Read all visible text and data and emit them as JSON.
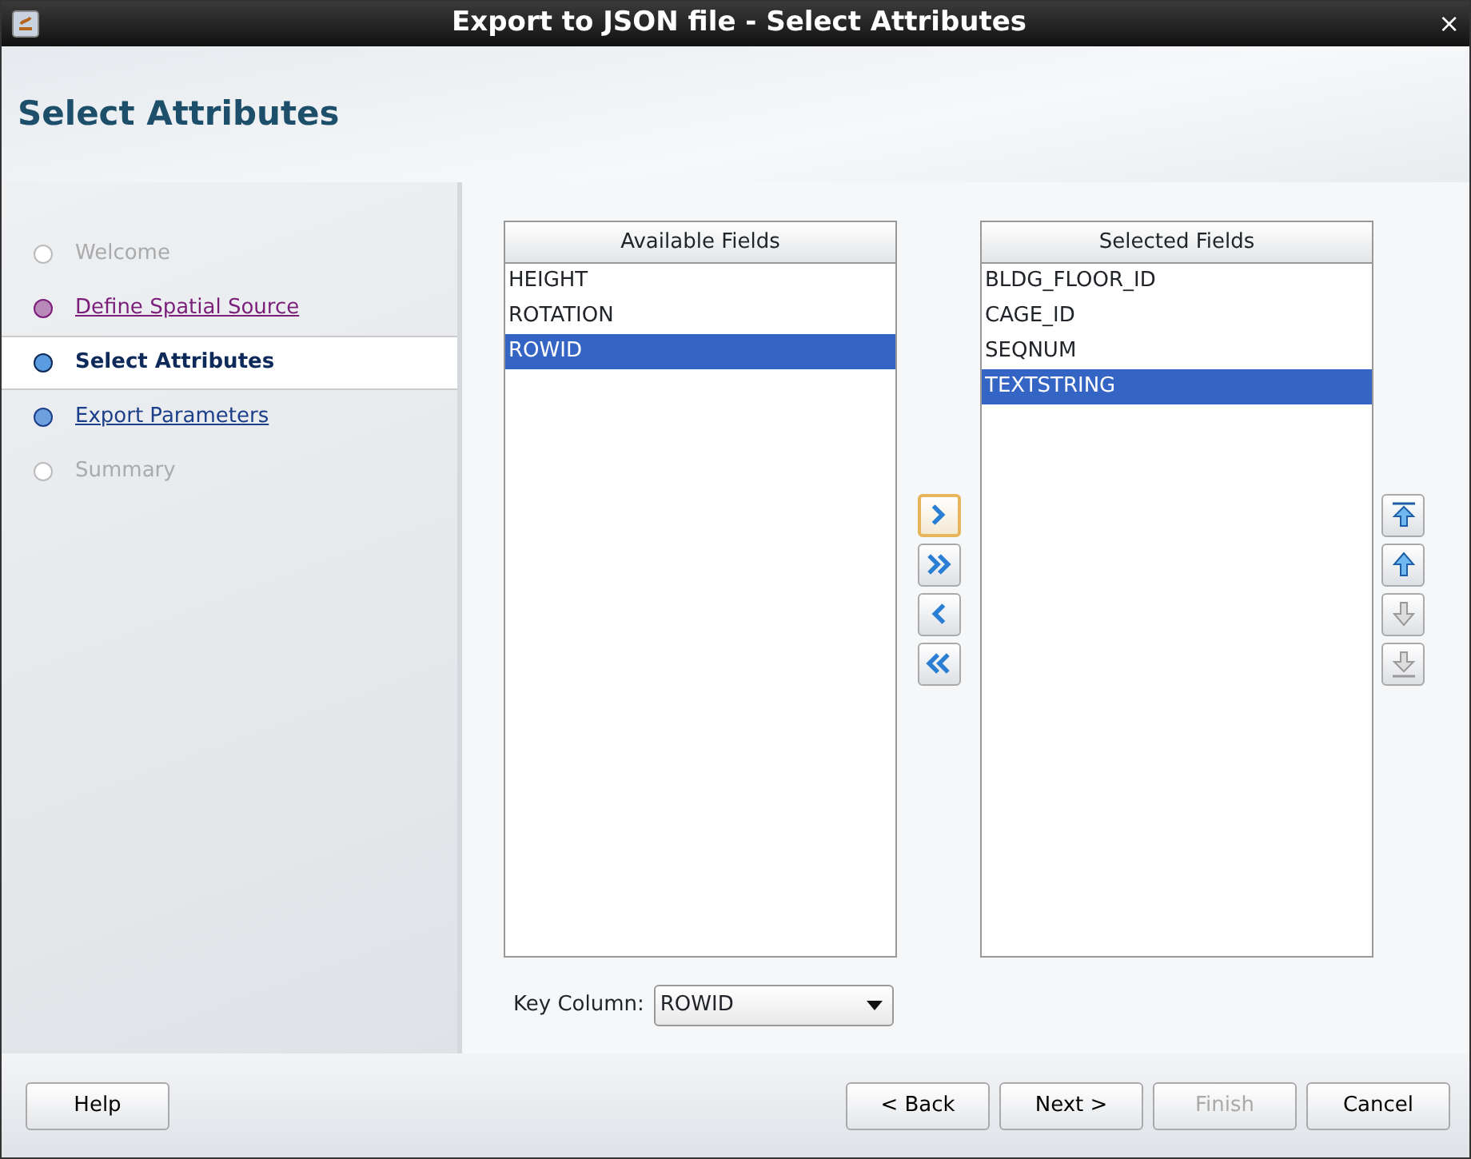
{
  "window": {
    "title": "Export to JSON file - Select Attributes",
    "close": "×"
  },
  "header": {
    "title": "Select Attributes"
  },
  "steps": [
    {
      "label": "Welcome",
      "selected": false,
      "disabled": true,
      "visited": false
    },
    {
      "label": "Define Spatial Source",
      "selected": false,
      "disabled": false,
      "visited": true
    },
    {
      "label": "Select Attributes",
      "selected": true,
      "disabled": false,
      "visited": false
    },
    {
      "label": "Export Parameters",
      "selected": false,
      "disabled": false,
      "visited": false
    },
    {
      "label": "Summary",
      "selected": false,
      "disabled": true,
      "visited": false
    }
  ],
  "available": {
    "heading": "Available Fields",
    "items": [
      {
        "label": "HEIGHT",
        "selected": false
      },
      {
        "label": "ROTATION",
        "selected": false
      },
      {
        "label": "ROWID",
        "selected": true
      }
    ]
  },
  "transfer_buttons": [
    {
      "kind": "move-right",
      "focused": true,
      "disabled": false
    },
    {
      "kind": "move-all-right",
      "focused": false,
      "disabled": false
    },
    {
      "kind": "move-left",
      "focused": false,
      "disabled": false
    },
    {
      "kind": "move-all-left",
      "focused": false,
      "disabled": false
    }
  ],
  "selected_fields": {
    "heading": "Selected Fields",
    "items": [
      {
        "label": "BLDG_FLOOR_ID",
        "selected": false
      },
      {
        "label": "CAGE_ID",
        "selected": false
      },
      {
        "label": "SEQNUM",
        "selected": false
      },
      {
        "label": "TEXTSTRING",
        "selected": true
      }
    ]
  },
  "order_buttons": [
    {
      "kind": "top",
      "disabled": false
    },
    {
      "kind": "up",
      "disabled": false
    },
    {
      "kind": "down",
      "disabled": true
    },
    {
      "kind": "bottom",
      "disabled": true
    }
  ],
  "key_column": {
    "label": "Key Column:",
    "value": "ROWID"
  },
  "buttons": [
    {
      "label": "Help",
      "kind": "left",
      "disabled": false
    },
    {
      "label": "< Back",
      "kind": "right",
      "disabled": false
    },
    {
      "label": "Next >",
      "kind": "right",
      "disabled": false
    },
    {
      "label": "Finish",
      "kind": "right",
      "disabled": true
    },
    {
      "label": "Cancel",
      "kind": "right",
      "disabled": false
    }
  ]
}
